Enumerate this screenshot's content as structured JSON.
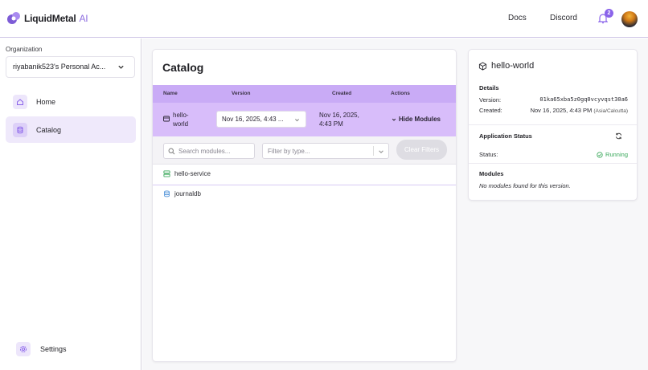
{
  "header": {
    "brand": "LiquidMetal",
    "brand_suffix": "AI",
    "nav": [
      {
        "label": "Docs"
      },
      {
        "label": "Discord"
      }
    ],
    "notification_count": "2"
  },
  "sidebar": {
    "org_label": "Organization",
    "org_value": "riyabanik523's Personal Ac...",
    "items": [
      {
        "label": "Home",
        "icon": "home-icon",
        "active": false
      },
      {
        "label": "Catalog",
        "icon": "database-icon",
        "active": true
      }
    ],
    "settings_label": "Settings"
  },
  "catalog": {
    "title": "Catalog",
    "columns": [
      "Name",
      "Version",
      "Created",
      "Actions"
    ],
    "row": {
      "name_line1": "hello-",
      "name_line2": "world",
      "version": "Nov 16, 2025, 4:43 ...",
      "created_line1": "Nov 16, 2025,",
      "created_line2": "4:43 PM",
      "action": "Hide Modules"
    },
    "search_placeholder": "Search modules...",
    "filter_placeholder": "Filter by type...",
    "clear_label": "Clear Filters",
    "modules": [
      {
        "name": "hello-service",
        "icon": "service-icon"
      },
      {
        "name": "journaldb",
        "icon": "database-icon"
      }
    ]
  },
  "detail": {
    "title": "hello-world",
    "details_heading": "Details",
    "version_label": "Version:",
    "version_value": "01ka65xba5z0gq0vcyvqst30a6",
    "created_label": "Created:",
    "created_value": "Nov 16, 2025, 4:43 PM",
    "created_tz": "(Asia/Calcutta)",
    "status_heading": "Application Status",
    "status_label": "Status:",
    "status_value": "Running",
    "modules_heading": "Modules",
    "modules_empty": "No modules found for this version."
  },
  "colors": {
    "accent": "#8a63ea",
    "header_row": "#c9abf6",
    "selected_row": "#d8bdfa",
    "running": "#3aa85b"
  }
}
